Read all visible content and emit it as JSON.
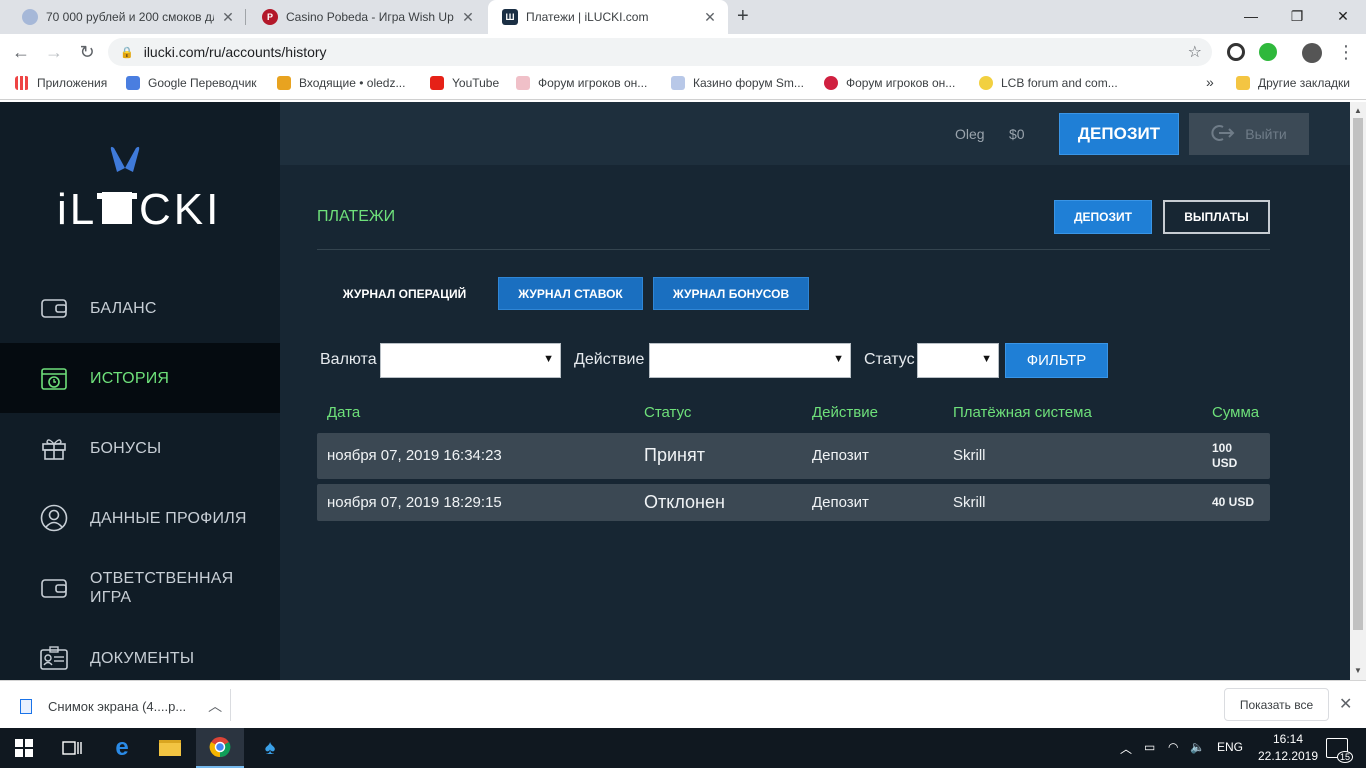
{
  "browser": {
    "tabs": [
      {
        "title": "70 000 рублей и 200 смоков дл",
        "active": false
      },
      {
        "title": "Casino Pobeda - Игра Wish Upo",
        "active": false
      },
      {
        "title": "Платежи | iLUCKI.com",
        "active": true
      }
    ],
    "url": "ilucki.com/ru/accounts/history",
    "bookmarks": [
      "Приложения",
      "Google Переводчик",
      "Входящие • oledz...",
      "YouTube",
      "Форум игроков он...",
      "Казино форум Sm...",
      "Форум игроков он...",
      "LCB forum and com...",
      "Другие закладки"
    ],
    "bookmarks_overflow": "»"
  },
  "site": {
    "logo_text": "iLUCKI",
    "nav": [
      {
        "label": "БАЛАНС",
        "active": false
      },
      {
        "label": "ИСТОРИЯ",
        "active": true
      },
      {
        "label": "БОНУСЫ",
        "active": false
      },
      {
        "label": "ДАННЫЕ ПРОФИЛЯ",
        "active": false
      },
      {
        "label": "ОТВЕТСТВЕННАЯ ИГРА",
        "active": false
      },
      {
        "label": "ДОКУМЕНТЫ",
        "active": false
      }
    ],
    "header": {
      "username": "Oleg",
      "balance": "$0",
      "deposit_label": "ДЕПОЗИТ",
      "logout_label": "Выйти"
    },
    "section_title": "ПЛАТЕЖИ",
    "actions": {
      "deposit": "ДЕПОЗИТ",
      "payouts": "ВЫПЛАТЫ"
    },
    "subtabs": [
      "ЖУРНАЛ ОПЕРАЦИЙ",
      "ЖУРНАЛ СТАВОК",
      "ЖУРНАЛ БОНУСОВ"
    ],
    "filters": {
      "currency_label": "Валюта",
      "currency_value": "",
      "action_label": "Действие",
      "action_value": "",
      "status_label": "Статус",
      "status_value": "",
      "filter_button": "ФИЛЬТР"
    },
    "table": {
      "headers": [
        "Дата",
        "Статус",
        "Действие",
        "Платёжная система",
        "Сумма"
      ],
      "rows": [
        {
          "date": "ноября 07, 2019 16:34:23",
          "status": "Принят",
          "action": "Депозит",
          "system": "Skrill",
          "amount": "100 USD"
        },
        {
          "date": "ноября 07, 2019 18:29:15",
          "status": "Отклонен",
          "action": "Депозит",
          "system": "Skrill",
          "amount": "40 USD"
        }
      ]
    },
    "colors": {
      "accent_green": "#6ee07a",
      "accent_blue": "#1f7fd6",
      "background": "#172633"
    }
  },
  "downloads": {
    "file": "Снимок экрана (4....p...",
    "show_all": "Показать все"
  },
  "taskbar": {
    "lang": "ENG",
    "time": "16:14",
    "date": "22.12.2019",
    "notifications": "15"
  }
}
